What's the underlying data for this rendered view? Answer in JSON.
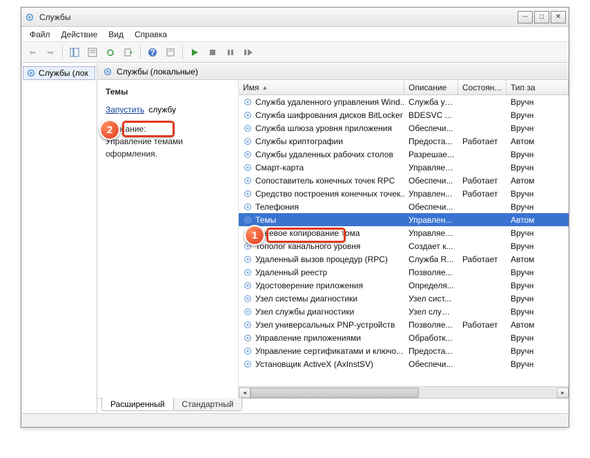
{
  "title": "Службы",
  "menu": {
    "file": "Файл",
    "action": "Действие",
    "view": "Вид",
    "help": "Справка"
  },
  "tree": {
    "root": "Службы (лок"
  },
  "mainHeader": "Службы (локальные)",
  "detail": {
    "selectedName": "Темы",
    "startLink": "Запустить",
    "startSuffix": "службу",
    "descLabel": "Описание:",
    "descText": "Управление темами оформления."
  },
  "columns": {
    "name": "Имя",
    "desc": "Описание",
    "state": "Состоян...",
    "type": "Тип за"
  },
  "rows": [
    {
      "name": "Служба удаленного управления Wind...",
      "desc": "Служба уд...",
      "state": "",
      "type": "Вручн"
    },
    {
      "name": "Служба шифрования дисков BitLocker",
      "desc": "BDESVC ...",
      "state": "",
      "type": "Вручн"
    },
    {
      "name": "Служба шлюза уровня приложения",
      "desc": "Обеспечи...",
      "state": "",
      "type": "Вручн"
    },
    {
      "name": "Службы криптографии",
      "desc": "Предоста...",
      "state": "Работает",
      "type": "Автом"
    },
    {
      "name": "Службы удаленных рабочих столов",
      "desc": "Разрешае...",
      "state": "",
      "type": "Вручн"
    },
    {
      "name": "Смарт-карта",
      "desc": "Управляет...",
      "state": "",
      "type": "Вручн"
    },
    {
      "name": "Сопоставитель конечных точек RPC",
      "desc": "Обеспечи...",
      "state": "Работает",
      "type": "Автом"
    },
    {
      "name": "Средство построения конечных точек...",
      "desc": "Управлен...",
      "state": "Работает",
      "type": "Вручн"
    },
    {
      "name": "Телефония",
      "desc": "Обеспечи...",
      "state": "",
      "type": "Вручн"
    },
    {
      "name": "Темы",
      "desc": "Управлен...",
      "state": "",
      "type": "Автом",
      "selected": true
    },
    {
      "name": "Теневое копирование тома",
      "desc": "Управляет...",
      "state": "",
      "type": "Вручн"
    },
    {
      "name": "Тополог канального уровня",
      "desc": "Создает к...",
      "state": "",
      "type": "Вручн"
    },
    {
      "name": "Удаленный вызов процедур (RPC)",
      "desc": "Служба R...",
      "state": "Работает",
      "type": "Автом"
    },
    {
      "name": "Удаленный реестр",
      "desc": "Позволяе...",
      "state": "",
      "type": "Вручн"
    },
    {
      "name": "Удостоверение приложения",
      "desc": "Определя...",
      "state": "",
      "type": "Вручн"
    },
    {
      "name": "Узел системы диагностики",
      "desc": "Узел сист...",
      "state": "",
      "type": "Вручн"
    },
    {
      "name": "Узел службы диагностики",
      "desc": "Узел служ...",
      "state": "",
      "type": "Вручн"
    },
    {
      "name": "Узел универсальных PNP-устройств",
      "desc": "Позволяе...",
      "state": "Работает",
      "type": "Автом"
    },
    {
      "name": "Управление приложениями",
      "desc": "Обработк...",
      "state": "",
      "type": "Вручн"
    },
    {
      "name": "Управление сертификатами и ключо...",
      "desc": "Предоста...",
      "state": "",
      "type": "Вручн"
    },
    {
      "name": "Установщик ActiveX (AxInstSV)",
      "desc": "Обеспечи...",
      "state": "",
      "type": "Вручн"
    }
  ],
  "tabs": {
    "extended": "Расширенный",
    "standard": "Стандартный"
  },
  "callouts": {
    "one": "1",
    "two": "2"
  }
}
